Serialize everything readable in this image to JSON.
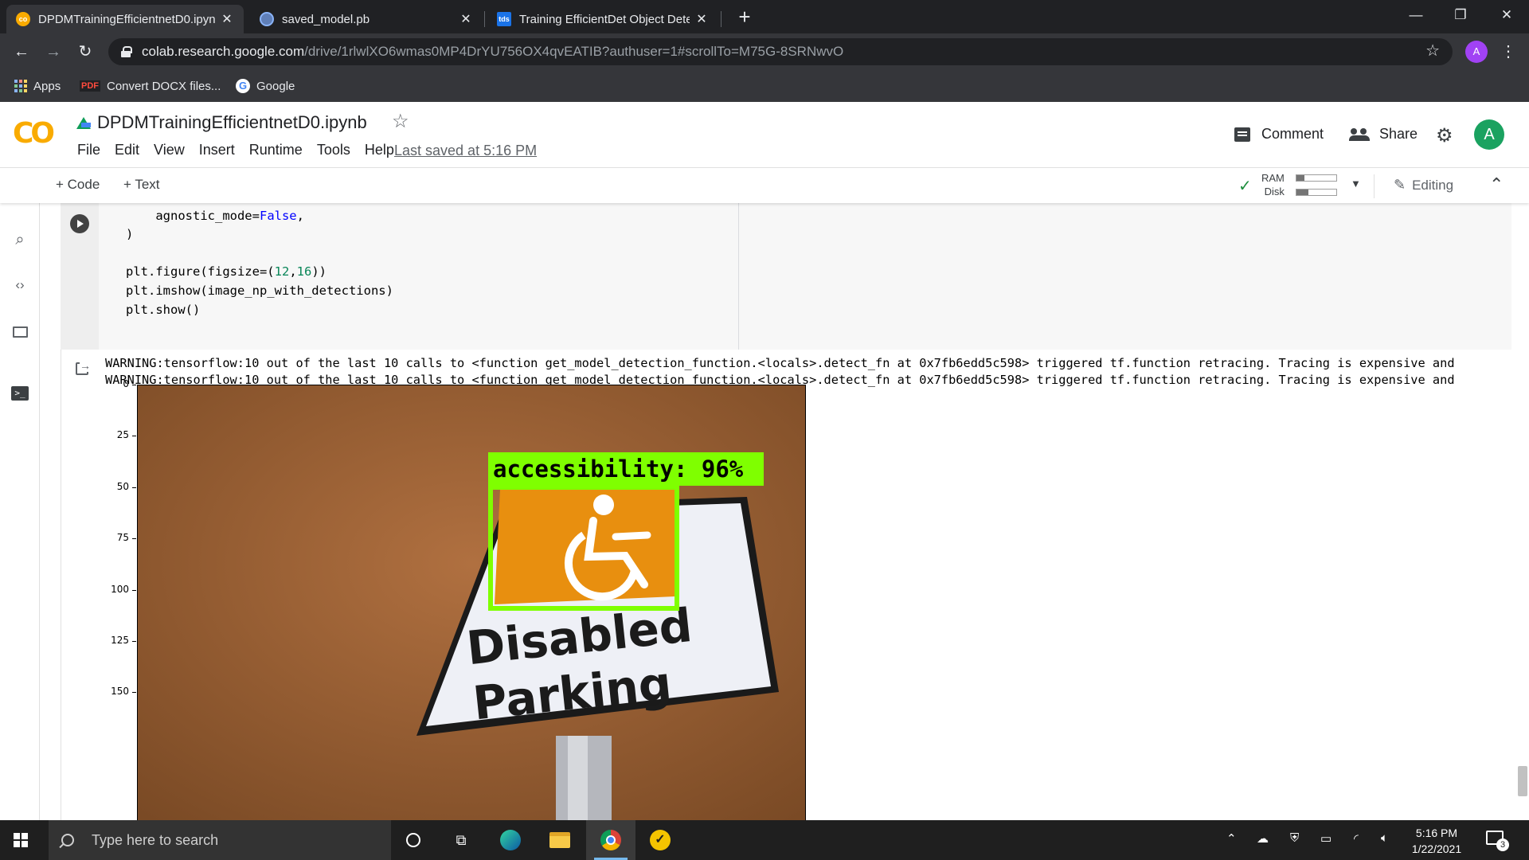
{
  "browser": {
    "tabs": [
      {
        "title": "DPDMTrainingEfficientnetD0.ipyn",
        "favicon": "colab-icon",
        "active": true
      },
      {
        "title": "saved_model.pb",
        "favicon": "globe-icon",
        "active": false
      },
      {
        "title": "Training EfficientDet Object Dete",
        "favicon": "tds-icon",
        "active": false
      }
    ],
    "tds_favicon_text": "tds",
    "url_host": "colab.research.google.com",
    "url_path": "/drive/1rlwlXO6wmas0MP4DrYU756OX4qvEATIB?authuser=1#scrollTo=M75G-8SRNwvO",
    "profile_initial": "A",
    "bookmarks": [
      {
        "label": "Apps",
        "icon": "apps-grid-icon"
      },
      {
        "label": "Convert DOCX files...",
        "icon": "pdf-icon",
        "icon_text": "PDF"
      },
      {
        "label": "Google",
        "icon": "google-icon",
        "icon_text": "G"
      }
    ]
  },
  "colab": {
    "logo": "CO",
    "notebook_title": "DPDMTrainingEfficientnetD0.ipynb",
    "menu": [
      "File",
      "Edit",
      "View",
      "Insert",
      "Runtime",
      "Tools",
      "Help"
    ],
    "last_saved": "Last saved at 5:16 PM",
    "comment_label": "Comment",
    "share_label": "Share",
    "avatar_initial": "A",
    "add_code": "+ Code",
    "add_text": "+ Text",
    "ram_label": "RAM",
    "disk_label": "Disk",
    "ram_fill": 0.2,
    "disk_fill": 0.3,
    "editing_label": "Editing"
  },
  "cell": {
    "code": {
      "line1_prefix": "    agnostic_mode=",
      "line1_value": "False",
      "line1_suffix": ",",
      "line2": ")",
      "line3_prefix": "plt.figure(figsize=(",
      "line3_a": "12",
      "line3_sep": ",",
      "line3_b": "16",
      "line3_suffix": "))",
      "line4": "plt.imshow(image_np_with_detections)",
      "line5": "plt.show()"
    },
    "output": {
      "warnings": [
        "WARNING:tensorflow:10 out of the last 10 calls to <function get_model_detection_function.<locals>.detect_fn at 0x7fb6edd5c598> triggered tf.function retracing. Tracing is expensive and",
        "WARNING:tensorflow:10 out of the last 10 calls to <function get_model_detection_function.<locals>.detect_fn at 0x7fb6edd5c598> triggered tf.function retracing. Tracing is expensive and"
      ],
      "y_ticks": [
        "0",
        "25",
        "50",
        "75",
        "100",
        "125",
        "150"
      ],
      "detection_label": "accessibility:  96%",
      "sign_text_line1": "Disabled",
      "sign_text_line2": "Parking"
    }
  },
  "chart_data": {
    "type": "image",
    "title": "",
    "ylabel": "",
    "xlabel": "",
    "y_ticks": [
      0,
      25,
      50,
      75,
      100,
      125,
      150
    ]
  },
  "taskbar": {
    "search_placeholder": "Type here to search",
    "time": "5:16 PM",
    "date": "1/22/2021",
    "notification_count": "3"
  },
  "colors": {
    "detection_box": "#7fff00",
    "tab_bar": "#202124",
    "toolbar": "#35363a",
    "colab_orange": "#f9ab00"
  }
}
